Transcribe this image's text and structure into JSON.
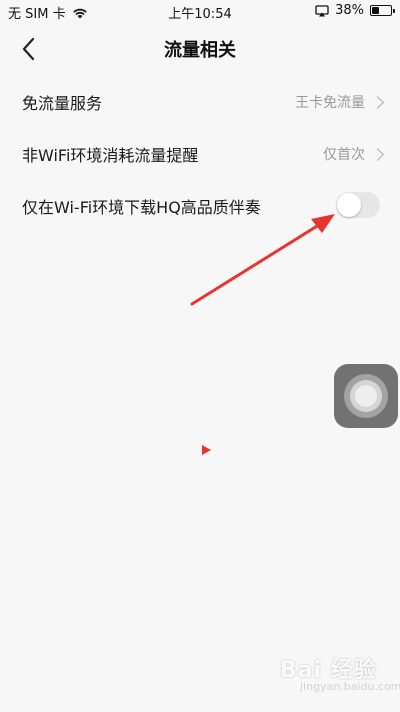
{
  "status_bar": {
    "carrier": "无 SIM 卡",
    "time": "上午10:54",
    "battery_percent": "38%",
    "battery_level": 0.38
  },
  "nav": {
    "title": "流量相关"
  },
  "settings": [
    {
      "label": "免流量服务",
      "value": "王卡免流量"
    },
    {
      "label": "非WiFi环境消耗流量提醒",
      "value": "仅首次"
    },
    {
      "label": "仅在Wi-Fi环境下载HQ高品质伴奏",
      "toggle_on": false
    }
  ],
  "colors": {
    "background": "#f7f7f7",
    "annotation_red": "#e8332f",
    "toggle_off": "#e6e6e6"
  },
  "watermark": {
    "text": "Bai 经验",
    "sub": "jingyan.baidu.com"
  }
}
